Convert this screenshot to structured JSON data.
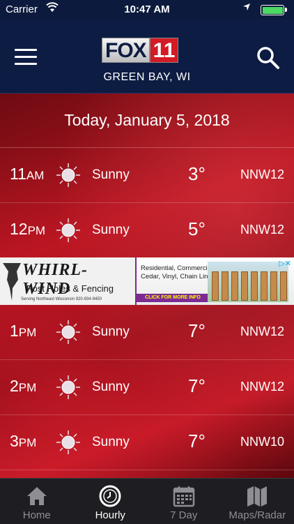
{
  "status_bar": {
    "carrier": "Carrier",
    "time": "10:47 AM"
  },
  "header": {
    "logo_fox": "FOX",
    "logo_number": "11",
    "location": "GREEN BAY, WI"
  },
  "date_heading": "Today, January 5, 2018",
  "hourly": [
    {
      "hour": "11",
      "ampm": "AM",
      "condition": "Sunny",
      "temp": "3°",
      "wind": "NNW12"
    },
    {
      "hour": "12",
      "ampm": "PM",
      "condition": "Sunny",
      "temp": "5°",
      "wind": "NNW12"
    },
    {
      "hour": "1",
      "ampm": "PM",
      "condition": "Sunny",
      "temp": "7°",
      "wind": "NNW12"
    },
    {
      "hour": "2",
      "ampm": "PM",
      "condition": "Sunny",
      "temp": "7°",
      "wind": "NNW12"
    },
    {
      "hour": "3",
      "ampm": "PM",
      "condition": "Sunny",
      "temp": "7°",
      "wind": "NNW10"
    }
  ],
  "ad": {
    "brand": "WHIRL-WIND",
    "subtitle": "Post Holes & Fencing",
    "serving": "Serving Northeast Wisconsin   920-934-9450",
    "line1": "Residential, Commercial",
    "line2": "Cedar, Vinyl, Chain Link",
    "cta": "CLICK FOR MORE INFO"
  },
  "tabs": [
    {
      "label": "Home",
      "icon": "home-icon"
    },
    {
      "label": "Hourly",
      "icon": "clock-icon"
    },
    {
      "label": "7 Day",
      "icon": "calendar-icon"
    },
    {
      "label": "Maps/Radar",
      "icon": "map-icon"
    }
  ],
  "colors": {
    "header_bg": "#0d1c42",
    "accent_red": "#d21b25",
    "battery_green": "#4cd964",
    "tab_inactive": "#8e8e93"
  }
}
